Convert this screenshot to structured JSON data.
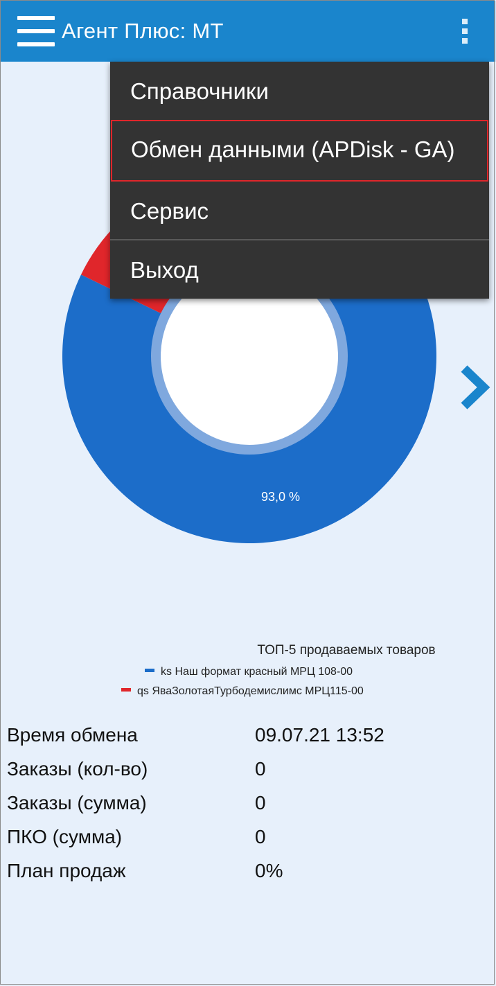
{
  "app": {
    "title": "Агент Плюс: МТ",
    "bar_color": "#1a85cc"
  },
  "menu": {
    "items": [
      {
        "label": "Справочники"
      },
      {
        "label": "Обмен данными (APDisk - GA)",
        "highlighted": true
      },
      {
        "label": "Сервис"
      },
      {
        "label": "Выход"
      }
    ],
    "background": "#333333",
    "highlight_color": "#e0262b"
  },
  "chart_data": {
    "type": "pie",
    "title": "ТОП-5 продаваемых товаров",
    "legend": "bottom-right",
    "series": [
      {
        "name": "ks Наш формат красный МРЦ 108-00",
        "value": 93.0,
        "label": "93,0 %",
        "color": "#1c6dc9"
      },
      {
        "name": "qs ЯваЗолотаяТурбодемислимс МРЦ115-00",
        "value": 7.0,
        "label": "",
        "color": "#e0262b"
      }
    ]
  },
  "stats": [
    {
      "label": "Время обмена",
      "value": "09.07.21 13:52"
    },
    {
      "label": "Заказы (кол-во)",
      "value": "0"
    },
    {
      "label": "Заказы (сумма)",
      "value": "0"
    },
    {
      "label": "ПКО (сумма)",
      "value": "0"
    },
    {
      "label": "План продаж",
      "value": "0%"
    }
  ],
  "icons": {
    "menu": "hamburger-menu-icon",
    "overflow": "more-vertical-icon",
    "next": "chevron-right-icon"
  }
}
